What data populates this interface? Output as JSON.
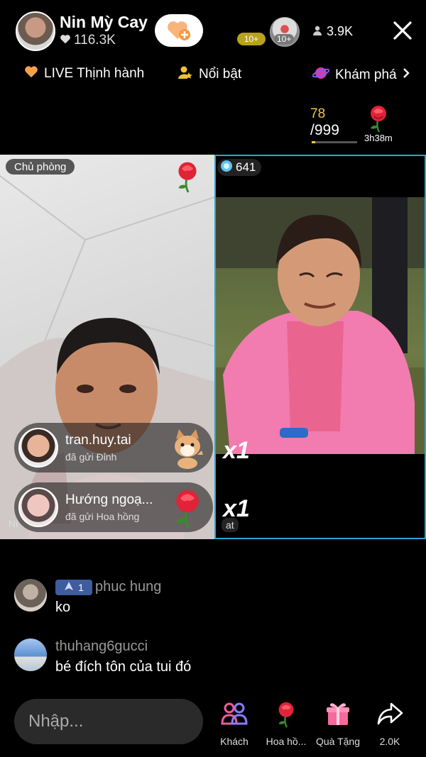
{
  "host": {
    "name": "Nin Mỳ Cay",
    "likes": "116.3K"
  },
  "viewers": {
    "level_badge": "10+",
    "avatar_level": "10+",
    "count": "3.9K"
  },
  "tabs": [
    {
      "label": "LIVE Thịnh hành",
      "icon": "orange-heart-icon"
    },
    {
      "label": "Nổi bật",
      "icon": "user-star-icon"
    },
    {
      "label": "Khám phá",
      "icon": "planet-icon"
    }
  ],
  "goal": {
    "current": "78",
    "target": "/999",
    "progress": 0.078,
    "timer": "3h38m"
  },
  "battle": {
    "host_tag": "Chủ phòng",
    "opponent_score": "641",
    "multiplier_1": "x1",
    "multiplier_2": "x1",
    "left_caption": "Ni",
    "right_caption": "at"
  },
  "gifts": [
    {
      "user": "tran.huy.tai",
      "desc": "đã gửi Đỉnh",
      "icon": "cat-gift-icon"
    },
    {
      "user": "Hướng ngoạ...",
      "desc": "đã gửi Hoa hồng",
      "icon": "rose-gift-icon"
    }
  ],
  "comments": [
    {
      "name": "phuc hung",
      "text": "ko",
      "rank": "1"
    },
    {
      "name": "thuhang6gucci",
      "text": "bé  đích tôn của tui đó"
    }
  ],
  "bottom": {
    "input_placeholder": "Nhập...",
    "buttons": [
      {
        "label": "Khách",
        "icon": "guests-icon"
      },
      {
        "label": "Hoa hồ...",
        "icon": "rose-icon"
      },
      {
        "label": "Quà Tặng",
        "icon": "gift-box-icon"
      },
      {
        "label": "2.0K",
        "icon": "share-icon"
      }
    ]
  },
  "colors": {
    "accent_blue": "#2aa6d6",
    "gold": "#f0c64a",
    "rank_badge": "#3f5c9e"
  }
}
